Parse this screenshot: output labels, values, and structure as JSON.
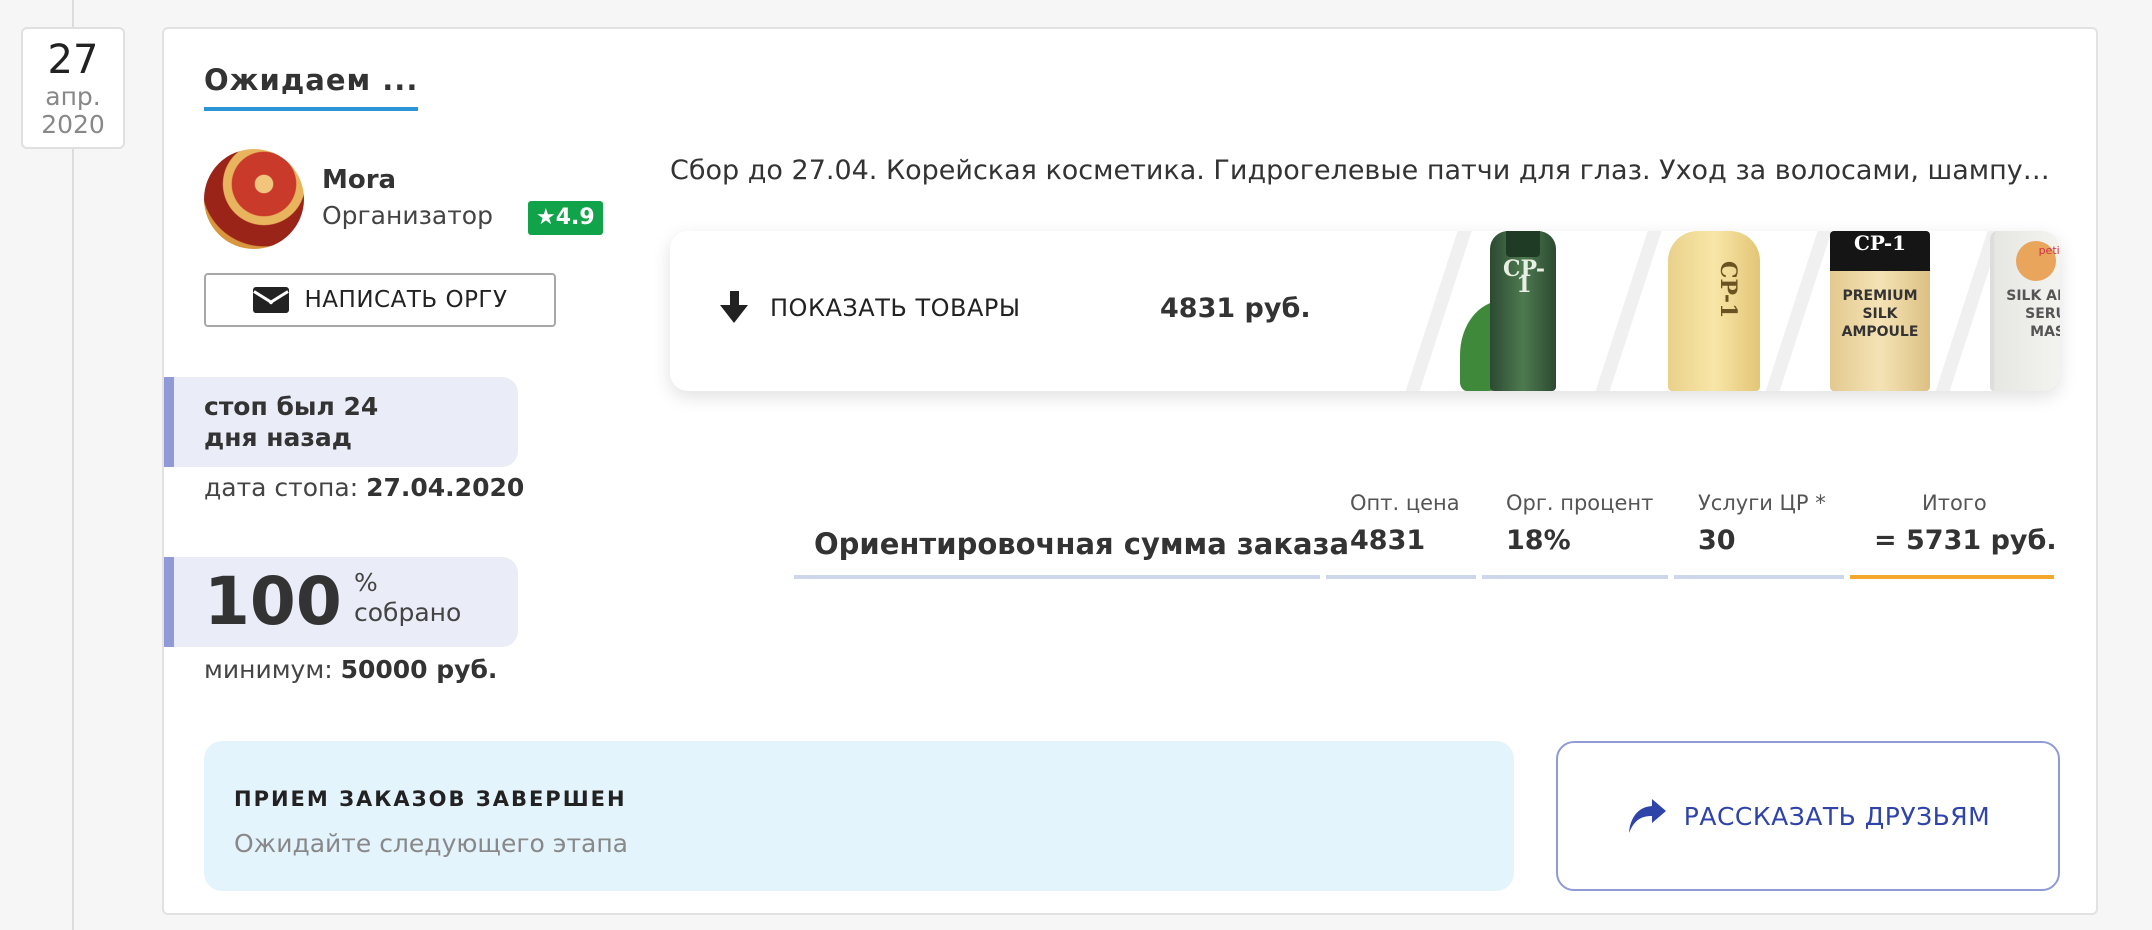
{
  "date": {
    "day": "27",
    "month": "апр.",
    "year": "2020"
  },
  "card": {
    "title": "Ожидаем ...",
    "organizer": {
      "name": "Mora",
      "role": "Организатор",
      "rating": "4.9",
      "write_button": "НАПИСАТЬ ОРГУ"
    },
    "stop": {
      "line1": "стоп был 24",
      "line2": "дня назад",
      "date_label": "дата стопа:",
      "date_value": "27.04.2020"
    },
    "collected": {
      "percent": "100",
      "unit": "%",
      "label": "собрано",
      "minimum_label": "минимум:",
      "minimum_value": "50000 руб."
    },
    "description": "Сбор до 27.04. Корейская косметика. Гидрогелевые патчи для глаз. Уход за волосами, шампуни, маски",
    "products": {
      "show_button": "ПОКАЗАТЬ ТОВАРЫ",
      "price": "4831 руб.",
      "label_1": "CP-1",
      "label_2": "CP-1",
      "label_3": "CP-1",
      "label_3b": "PREMIUM SILK AMPOULE",
      "label_4": "SILK AMINO SERUM MASK",
      "label_4_top": "petitfee"
    },
    "calc": {
      "main_label": "Ориентировочная сумма заказа",
      "opt_head": "Опт. цена",
      "opt_val": "4831",
      "org_head": "Орг. процент",
      "org_val": "18%",
      "service_head": "Услуги ЦР *",
      "service_val": "30",
      "total_head": "Итого",
      "total_val": "= 5731 руб."
    },
    "status": {
      "title": "ПРИЕМ ЗАКАЗОВ ЗАВЕРШЕН",
      "subtitle": "Ожидайте следующего этапа"
    },
    "share_button": "РАССКАЗАТЬ ДРУЗЬЯМ"
  },
  "colors": {
    "accent_blue": "#2b95d6",
    "rating_green": "#11a34a",
    "total_orange": "#f3a72c",
    "share_blue": "#2f44a8"
  }
}
